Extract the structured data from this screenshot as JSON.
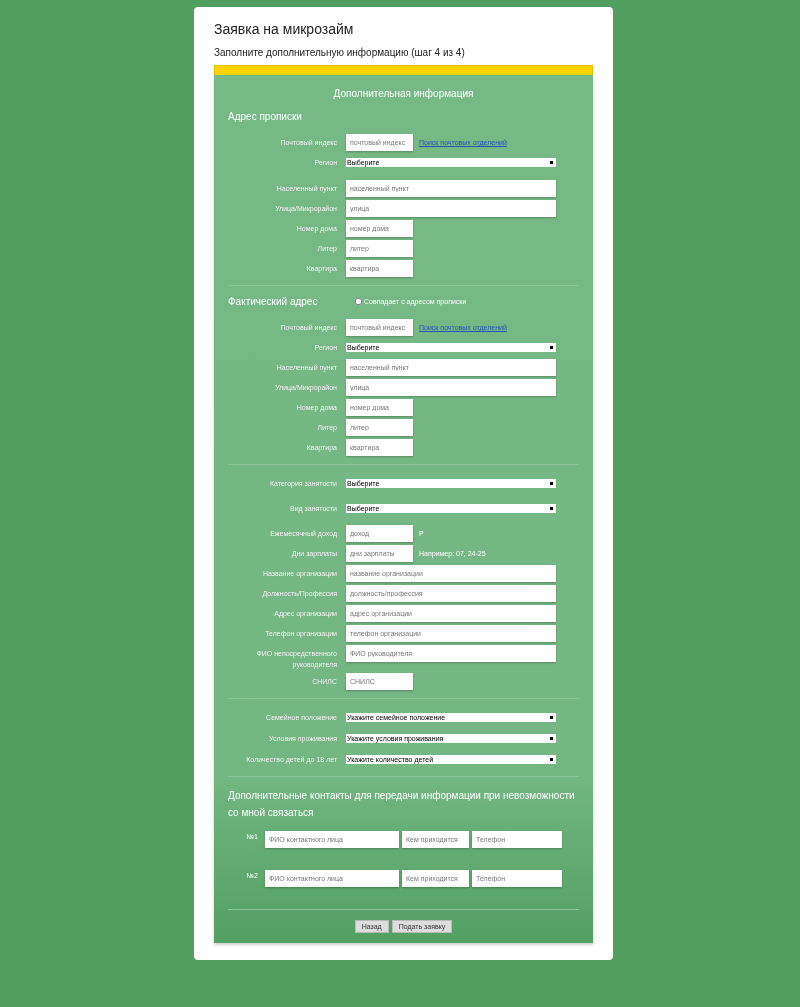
{
  "title": "Заявка на микрозайм",
  "subtitle": "Заполните дополнительную информацию (шаг 4 из 4)",
  "progress": {
    "level": 1
  },
  "form_heading": "Дополнительная информация",
  "sections": [
    {
      "kind": "fields",
      "title": "Адрес прописки",
      "fields": [
        {
          "label": "Почтовый индекс",
          "kind": "short",
          "placeholder": "почтовый индекс",
          "link": "Поиск почтовых отделений"
        },
        {
          "label": "Регион",
          "kind": "select",
          "value": "Выберите"
        },
        {
          "label": "Населенный пункт",
          "kind": "wide",
          "placeholder": "населенный пункт"
        },
        {
          "label": "Улица/Микрорайон",
          "kind": "wide",
          "placeholder": "улица"
        },
        {
          "label": "Номер дома",
          "kind": "short",
          "placeholder": "номер дома"
        },
        {
          "label": "Литер",
          "kind": "short",
          "placeholder": "литер"
        },
        {
          "label": "Квартира",
          "kind": "short",
          "placeholder": "квартира"
        }
      ]
    },
    {
      "kind": "fields",
      "title": "Фактический адрес",
      "checkbox": {
        "label": "Совпадает с адресом прописки",
        "checked": false
      },
      "fields": [
        {
          "label": "Почтовый индекс",
          "kind": "short",
          "placeholder": "почтовый индекс",
          "link": "Поиск почтовых отделений"
        },
        {
          "label": "Регион",
          "kind": "select",
          "value": "Выберите"
        },
        {
          "label": "Населенный пункт",
          "kind": "wide",
          "placeholder": "населенный пункт"
        },
        {
          "label": "Улица/Микрорайон",
          "kind": "wide",
          "placeholder": "улица"
        },
        {
          "label": "Номер дома",
          "kind": "short",
          "placeholder": "номер дома"
        },
        {
          "label": "Литер",
          "kind": "short",
          "placeholder": "литер"
        },
        {
          "label": "Квартира",
          "kind": "short",
          "placeholder": "квартира"
        }
      ]
    },
    {
      "kind": "fields",
      "fields": [
        {
          "label": "Категория занятости",
          "kind": "select",
          "value": "Выберите"
        },
        {
          "label": "Вид занятости",
          "kind": "select",
          "value": "Выберите"
        },
        {
          "label": "Ежемесячный доход",
          "kind": "short",
          "placeholder": "доход",
          "suffix": "Р"
        },
        {
          "label": "Дни зарплаты",
          "kind": "short",
          "placeholder": "дни зарплаты",
          "suffix": "Например: 07, 24-25"
        },
        {
          "label": "Название организации",
          "kind": "wide",
          "placeholder": "название организации"
        },
        {
          "label": "Должность/Профессия",
          "kind": "wide",
          "placeholder": "должность/профессия"
        },
        {
          "label": "Адрес организации",
          "kind": "wide",
          "placeholder": "адрес организации"
        },
        {
          "label": "Телефон организации",
          "kind": "wide",
          "placeholder": "телефон организации"
        },
        {
          "label": "ФИО непосредственного руководителя",
          "kind": "wide",
          "placeholder": "ФИО руководителя"
        },
        {
          "label": "СНИЛС",
          "kind": "short",
          "placeholder": "СНИЛС"
        }
      ]
    },
    {
      "kind": "fields",
      "fields": [
        {
          "label": "Семейное положение",
          "kind": "select",
          "value": "Укажите семейное положение"
        },
        {
          "label": "Условия проживания",
          "kind": "select",
          "value": "Укажите условия проживания"
        },
        {
          "label": "Количество детей до 18 лет",
          "kind": "select",
          "value": "Укажите количество детей"
        }
      ]
    },
    {
      "kind": "contacts",
      "title": "Дополнительные контакты для передачи информации при невозможности со мной связаться",
      "rows": [
        {
          "number": "№1",
          "placeholders": [
            "ФИО контактного лица",
            "Кем приходится",
            "Телефон"
          ]
        },
        {
          "number": "№2",
          "placeholders": [
            "ФИО контактного лица",
            "Кем приходится",
            "Телефон"
          ]
        }
      ]
    }
  ],
  "buttons": [
    "Назад",
    "Подать заявку"
  ]
}
